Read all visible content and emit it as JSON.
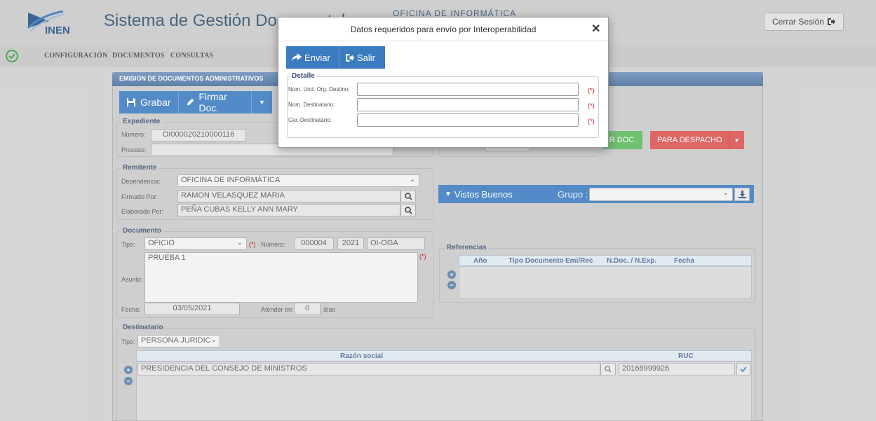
{
  "header": {
    "logo_text": "INEN",
    "app_title": "Sistema de Gestión Documental",
    "office_title": "OFICINA DE INFORMÁTICA",
    "logout_label": "Cerrar Sesión"
  },
  "menu": {
    "items": [
      {
        "label": "CONFIGURACIÓN"
      },
      {
        "label": "DOCUMENTOS"
      },
      {
        "label": "CONSULTAS"
      }
    ]
  },
  "panel": {
    "title": "EMISION DE DOCUMENTOS ADMINISTRATIVOS",
    "save_label": "Grabar",
    "sign_label": "Firmar Doc.",
    "green_label": "R DOC.",
    "dispatch_label": "PARA DESPACHO"
  },
  "expediente": {
    "legend": "Expediente",
    "numero_label": "Número:",
    "numero_value": "OI000020210000116",
    "proceso_label": "Proceso:",
    "proceso_value": ""
  },
  "remitente": {
    "legend": "Remitente",
    "dependencia_label": "Dependencia:",
    "dependencia_value": "OFICINA DE INFORMÁTICA",
    "firmado_label": "Firmado Por:",
    "firmado_value": "RAMON VELASQUEZ MARIA",
    "elaborado_label": "Elaborado Por:",
    "elaborado_value": "PEÑA CUBAS KELLY ANN MARY"
  },
  "documento": {
    "legend": "Documento",
    "tipo_label": "Tipo:",
    "tipo_value": "OFICIO",
    "req_mark": "(*)",
    "numero_label": "Número:",
    "numero_value": "000004",
    "anio_value": "2021",
    "siglas_value": "OI-OGA",
    "asunto_label": "Asunto:",
    "asunto_value": "PRUEBA 1",
    "fecha_label": "Fecha:",
    "fecha_value": "03/05/2021",
    "atender_label": "Atender en:",
    "atender_value": "0",
    "dias_label": "días"
  },
  "vistos": {
    "label": "Vistos Buenos",
    "grupo_label": "Grupo :",
    "grupo_value": ""
  },
  "referencias": {
    "legend": "Referencias",
    "columns": [
      "Año",
      "Tipo Documento",
      "Emi/Rec",
      "N.Doc. / N.Exp.",
      "Fecha"
    ]
  },
  "destinatario": {
    "legend": "Destinatario",
    "tipo_label": "Tipo:",
    "tipo_value": "PERSONA JURIDICA",
    "columns": [
      "Razón social",
      "RUC"
    ],
    "rows": [
      {
        "razon_social": "PRESIDENCIA DEL CONSEJO DE MINISTROS",
        "ruc": "20168999926"
      }
    ]
  },
  "modal": {
    "title": "Datos requeridos para envío por Interoperabilidad",
    "send_label": "Enviar",
    "exit_label": "Salir",
    "legend": "Detalle",
    "fields": [
      {
        "label": "Nom. Und. Org. Destino:",
        "value": "",
        "req": "(*)"
      },
      {
        "label": "Nom. Destinatario:",
        "value": "",
        "req": "(*)"
      },
      {
        "label": "Car. Destinatario:",
        "value": "",
        "req": "(*)"
      }
    ]
  },
  "colors": {
    "primary": "#3b7bc0",
    "success": "#5cb85c",
    "danger": "#d9534f",
    "title_blue": "#2e4f6e"
  }
}
